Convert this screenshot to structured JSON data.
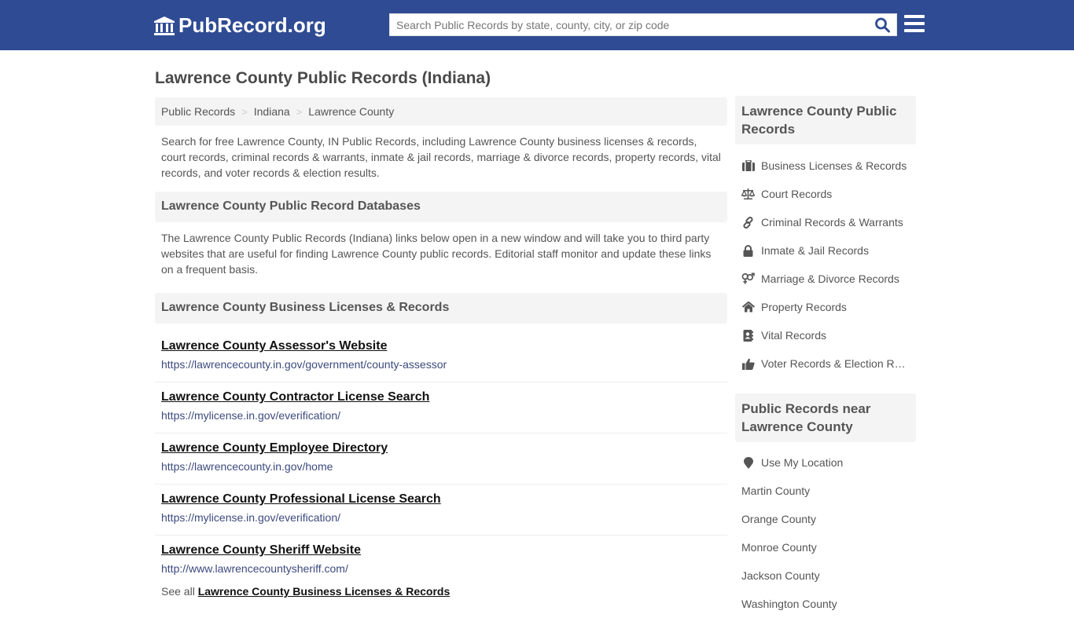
{
  "header": {
    "logo_text": "PubRecord.org",
    "search_placeholder": "Search Public Records by state, county, city, or zip code",
    "search_value": "",
    "colors": {
      "brand_bar": "#2f4b93",
      "search_icon": "#2f4b93"
    }
  },
  "page": {
    "title": "Lawrence County Public Records (Indiana)"
  },
  "breadcrumb": [
    {
      "label": "Public Records"
    },
    {
      "label": "Indiana"
    },
    {
      "label": "Lawrence County"
    }
  ],
  "breadcrumb_separator": ">",
  "intro": "Search for free Lawrence County, IN Public Records, including Lawrence County business licenses & records, court records, criminal records & warrants, inmate & jail records, marriage & divorce records, property records, vital records, and voter records & election results.",
  "databases": {
    "heading": "Lawrence County Public Record Databases",
    "description": "The Lawrence County Public Records (Indiana) links below open in a new window and will take you to third party websites that are useful for finding Lawrence County public records. Editorial staff monitor and update these links on a frequent basis."
  },
  "business": {
    "heading": "Lawrence County Business Licenses & Records",
    "links": [
      {
        "title": "Lawrence County Assessor's Website",
        "url": "https://lawrencecounty.in.gov/government/county-assessor"
      },
      {
        "title": "Lawrence County Contractor License Search",
        "url": "https://mylicense.in.gov/everification/"
      },
      {
        "title": "Lawrence County Employee Directory",
        "url": "https://lawrencecounty.in.gov/home"
      },
      {
        "title": "Lawrence County Professional License Search",
        "url": "https://mylicense.in.gov/everification/"
      },
      {
        "title": "Lawrence County Sheriff Website",
        "url": "http://www.lawrencecountysheriff.com/"
      }
    ],
    "see_all_prefix": "See all",
    "see_all_link": "Lawrence County Business Licenses & Records"
  },
  "sidebar": {
    "records_heading": "Lawrence County Public Records",
    "records": [
      {
        "label": "Business Licenses & Records",
        "icon": "briefcase-icon"
      },
      {
        "label": "Court Records",
        "icon": "scale-icon"
      },
      {
        "label": "Criminal Records & Warrants",
        "icon": "link-icon"
      },
      {
        "label": "Inmate & Jail Records",
        "icon": "lock-icon"
      },
      {
        "label": "Marriage & Divorce Records",
        "icon": "gender-icon"
      },
      {
        "label": "Property Records",
        "icon": "home-icon"
      },
      {
        "label": "Vital Records",
        "icon": "address-book-icon"
      },
      {
        "label": "Voter Records & Election Results",
        "icon": "thumbs-up-icon"
      }
    ],
    "near_heading": "Public Records near Lawrence County",
    "use_location": "Use My Location",
    "nearby": [
      "Martin County",
      "Orange County",
      "Monroe County",
      "Jackson County",
      "Washington County"
    ]
  }
}
